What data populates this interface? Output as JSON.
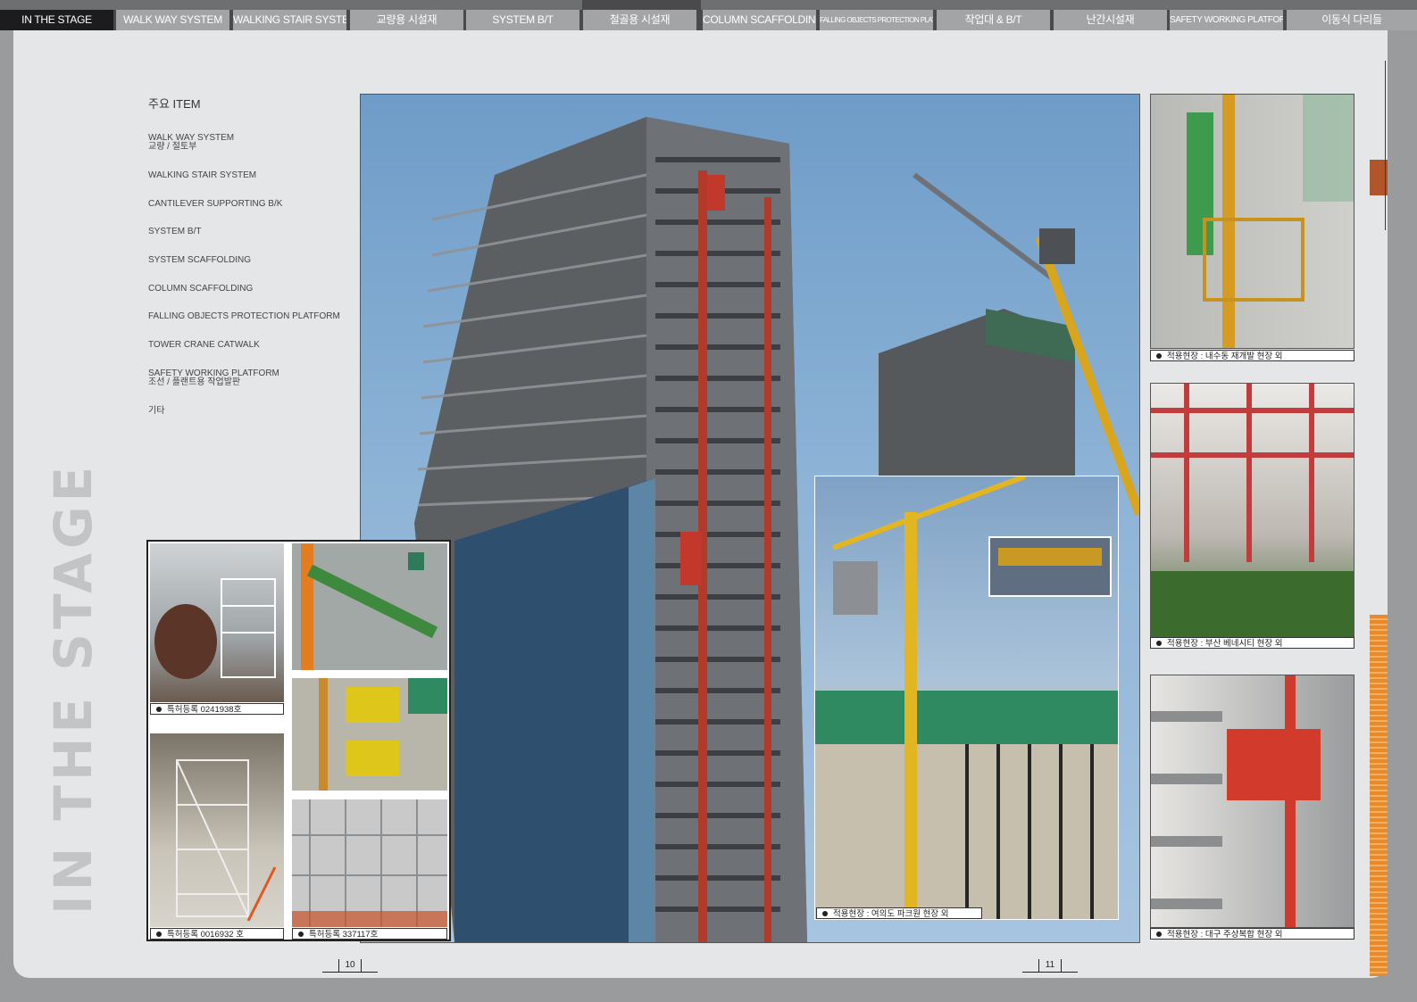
{
  "nav": {
    "tabs": [
      {
        "label": "IN THE STAGE",
        "active": true
      },
      {
        "label": "WALK WAY SYSTEM",
        "active": false
      },
      {
        "label": "WALKING STAIR SYSTEM",
        "active": false
      },
      {
        "label": "교량용 시설재",
        "active": false
      },
      {
        "label": "SYSTEM B/T",
        "active": false
      },
      {
        "label": "철골용 시설재",
        "active": false
      },
      {
        "label": "COLUMN SCAFFOLDING",
        "active": false
      },
      {
        "label": "FALLING OBJECTS PROTECTION PLATFORM",
        "active": false
      },
      {
        "label": "작업대 & B/T",
        "active": false
      },
      {
        "label": "난간시설재",
        "active": false
      },
      {
        "label": "SAFETY WORKING PLATFORM",
        "active": false
      },
      {
        "label": "이동식 다리들",
        "active": false
      }
    ]
  },
  "side_title": "IN THE STAGE",
  "items": {
    "heading": "주요 ITEM",
    "list": [
      {
        "line1": "WALK WAY SYSTEM",
        "line2": "교량 / 절토부"
      },
      {
        "line1": "WALKING STAIR SYSTEM",
        "line2": ""
      },
      {
        "line1": "CANTILEVER SUPPORTING B/K",
        "line2": ""
      },
      {
        "line1": "SYSTEM B/T",
        "line2": ""
      },
      {
        "line1": "SYSTEM SCAFFOLDING",
        "line2": ""
      },
      {
        "line1": "COLUMN SCAFFOLDING",
        "line2": ""
      },
      {
        "line1": "FALLING OBJECTS PROTECTION PLATFORM",
        "line2": ""
      },
      {
        "line1": "TOWER CRANE CATWALK",
        "line2": ""
      },
      {
        "line1": "SAFETY WORKING PLATFORM",
        "line2": "조선 / 플랜트용 작업발판"
      },
      {
        "line1": "기타",
        "line2": ""
      }
    ]
  },
  "captions": {
    "gallery_top_left": "특허등록  0241938호",
    "gallery_bottom_left": "특허등록  0016932 호",
    "gallery_bottom_right": "특허등록  337117호",
    "crane_inset": "적용현장 : 여의도 파크원 현장 외",
    "right_top": "적용현장 : 내수동 재개발 현장 외",
    "right_middle": "적용현장 : 부산 베네시티 현장 외",
    "right_bottom": "적용현장 : 대구 주상복합 현장 외"
  },
  "page_numbers": {
    "left": "10",
    "right": "11"
  },
  "colors": {
    "nav_dark": "#1c1c1e",
    "nav_tab": "#a3a4a6",
    "sheet": "#e5e6e8",
    "accent_orange": "#e88a2a"
  }
}
